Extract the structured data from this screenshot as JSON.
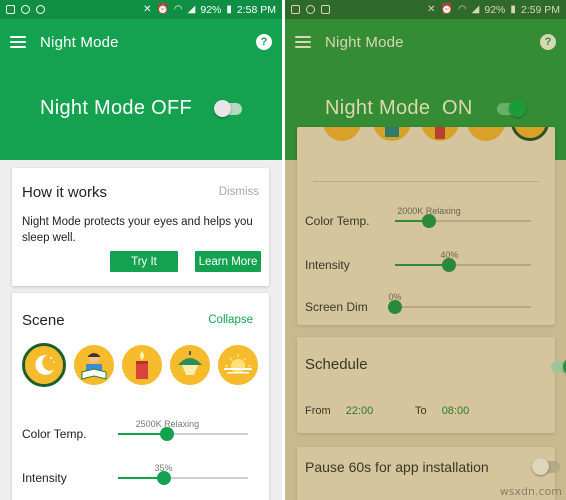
{
  "colors": {
    "accent": "#14a250",
    "accent_dark": "#0f8f43",
    "night_header": "#348c34",
    "night_bg": "#c9b98f"
  },
  "left": {
    "status": {
      "battery": "92%",
      "time": "2:58 PM"
    },
    "app_title": "Night Mode",
    "night_mode_label": "Night Mode OFF",
    "how_it_works": {
      "title": "How it works",
      "dismiss": "Dismiss",
      "text": "Night Mode protects your eyes and helps you sleep well.",
      "try_it": "Try It",
      "learn_more": "Learn More"
    },
    "scene": {
      "title": "Scene",
      "collapse": "Collapse",
      "icons": [
        "moon-icon",
        "reading-icon",
        "candle-icon",
        "lamp-icon",
        "sunset-icon"
      ],
      "color_temp": {
        "label": "Color Temp.",
        "caption": "2500K Relaxing",
        "value_fraction": 0.38
      },
      "intensity": {
        "label": "Intensity",
        "caption": "35%",
        "value_fraction": 0.35
      }
    }
  },
  "right": {
    "status": {
      "battery": "92%",
      "time": "2:59 PM"
    },
    "app_title": "Night Mode",
    "night_mode_label": "Night Mode  ON",
    "color_temp": {
      "label": "Color Temp.",
      "caption": "2000K Relaxing",
      "value_fraction": 0.25
    },
    "intensity": {
      "label": "Intensity",
      "caption": "40%",
      "value_fraction": 0.4
    },
    "screen_dim": {
      "label": "Screen Dim",
      "caption": "0%",
      "value_fraction": 0.0
    },
    "schedule": {
      "title": "Schedule",
      "from_label": "From",
      "from_value": "22:00",
      "to_label": "To",
      "to_value": "08:00"
    },
    "pause": {
      "title": "Pause 60s for app installation"
    }
  },
  "watermark": "wsxdn.com"
}
